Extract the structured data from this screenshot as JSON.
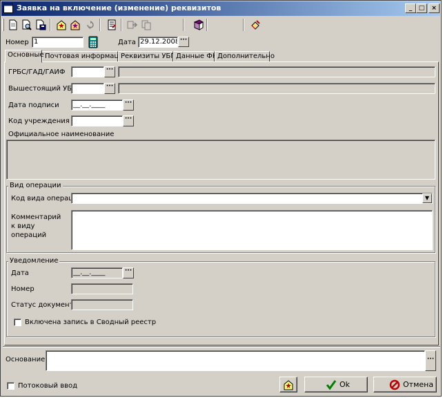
{
  "window": {
    "title": "Заявка на включение (изменение) реквизитов",
    "min_glyph": "_",
    "max_glyph": "□",
    "close_glyph": "×"
  },
  "header": {
    "number_label": "Номер",
    "number_value": "1",
    "date_label": "Дата",
    "date_value": "29.12.2008"
  },
  "tabs": [
    {
      "label": "Основные"
    },
    {
      "label": "Почтовая информация"
    },
    {
      "label": "Реквизиты УБП"
    },
    {
      "label": "Данные ФК"
    },
    {
      "label": "Дополнительно"
    }
  ],
  "main": {
    "grbs_label": "ГРБС/ГАД/ГАИФ",
    "superior_label": "Вышестоящий УБП",
    "sign_date_label": "Дата подписи",
    "sign_date_mask": "__.__.____",
    "institution_code_label": "Код учреждения",
    "official_name_label": "Официальное наименование"
  },
  "operation": {
    "group_title": "Вид операции",
    "code_label": "Код вида операции",
    "comment_label": "Комментарий к виду операций"
  },
  "notification": {
    "group_title": "Уведомление",
    "date_label": "Дата",
    "date_mask": "__.__.____",
    "number_label": "Номер",
    "status_label": "Статус документа",
    "included_checkbox_label": "Включена запись в Сводный реестр"
  },
  "footer": {
    "basis_label": "Основание",
    "stream_input_label": "Потоковый ввод",
    "ok_label": "Ok",
    "cancel_label": "Отмена"
  },
  "glyphs": {
    "ellipsis": "···",
    "dropdown": "▼"
  },
  "icons": [
    "app-window-icon",
    "new-document-icon",
    "preview-document-icon",
    "save-document-icon",
    "mark-icon",
    "mark-alt-icon",
    "refresh-icon",
    "edit-list-icon",
    "forward-icon",
    "copy-icon",
    "book-icon",
    "clear-icon",
    "calculator-icon"
  ]
}
